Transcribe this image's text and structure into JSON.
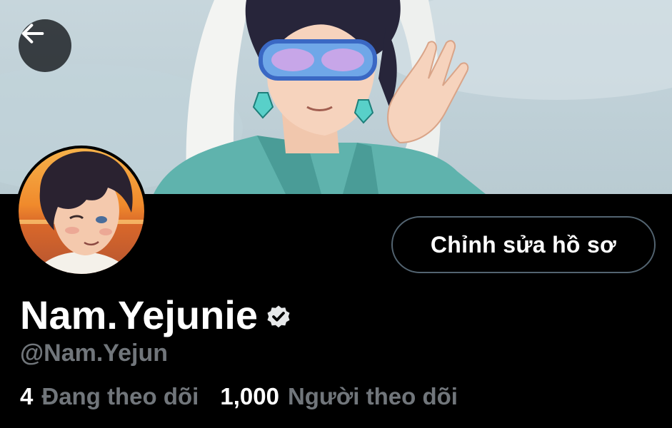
{
  "header": {
    "back_icon": "arrow-left-icon",
    "banner": "profile-banner-illustration"
  },
  "profile": {
    "display_name": "Nam.Yejunie",
    "verified_icon": "verified-badge-icon",
    "handle": "@Nam.Yejun",
    "edit_label": "Chỉnh sửa hồ sơ",
    "avatar": "profile-avatar-illustration"
  },
  "stats": {
    "following_count": "4",
    "following_label": "Đang theo dõi",
    "followers_count": "1,000",
    "followers_label": "Người theo dõi"
  },
  "colors": {
    "background": "#000000",
    "text": "#ffffff",
    "muted": "#71767b",
    "button_border": "#536471"
  }
}
